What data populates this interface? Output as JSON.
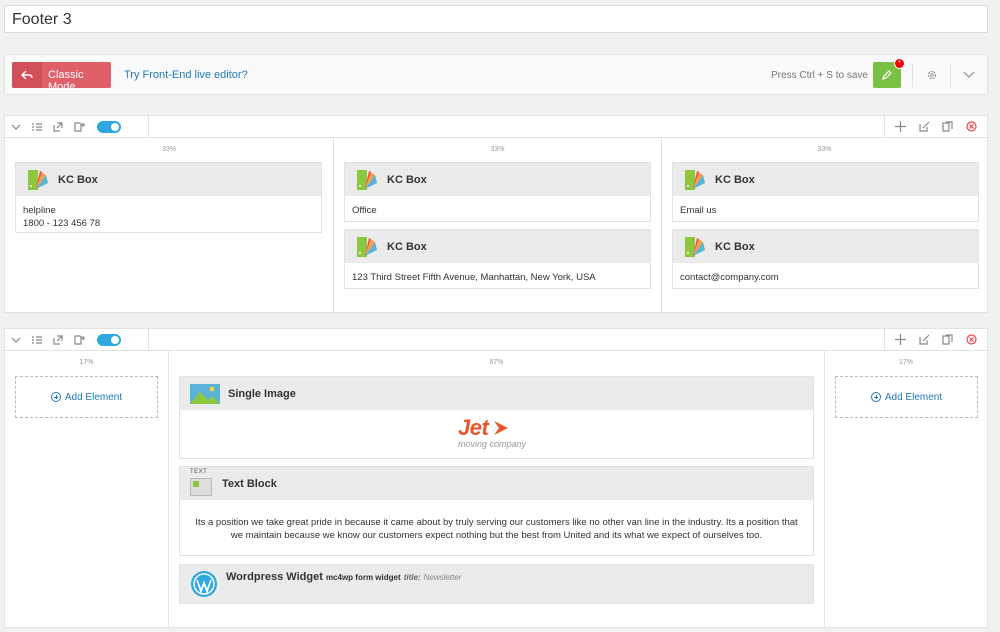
{
  "title": "Footer 3",
  "toolbar": {
    "classic_label": "Classic Mode",
    "frontend_link": "Try Front-End live editor?",
    "save_hint": "Press Ctrl + S to save",
    "save_badge": "*"
  },
  "colors": {
    "accent": "#1e7bb8",
    "classic": "#e0606a",
    "save": "#7ac143",
    "toggle": "#2ea8e0"
  },
  "row1": {
    "columns": [
      {
        "pct": "33%",
        "boxes": [
          {
            "title": "KC Box",
            "lines": [
              "helpline",
              "1800 - 123 456 78"
            ]
          }
        ]
      },
      {
        "pct": "33%",
        "boxes": [
          {
            "title": "KC Box",
            "lines": [
              "Office"
            ]
          },
          {
            "title": "KC Box",
            "lines": [
              "123 Third Street Fifth Avenue, Manhattan, New York, USA"
            ]
          }
        ]
      },
      {
        "pct": "33%",
        "boxes": [
          {
            "title": "KC Box",
            "lines": [
              "Email us"
            ]
          },
          {
            "title": "KC Box",
            "lines": [
              "contact@company.com"
            ]
          }
        ]
      }
    ]
  },
  "row2": {
    "left": {
      "pct": "17%",
      "add_label": "Add Element"
    },
    "center": {
      "pct": "67%",
      "single_image": {
        "title": "Single Image",
        "logo_main": "Jet",
        "logo_sub": "moving company"
      },
      "text_block": {
        "title": "Text Block",
        "icon_label": "TEXT",
        "text": "Its a position we take great pride in because it came about by truly serving our customers like no other van line in the industry. Its a position that we maintain because we know our customers expect nothing but the best from United and its what we expect of ourselves too."
      },
      "widget": {
        "title": "Wordpress Widget",
        "widget_name": "mc4wp form widget",
        "title_key": "title:",
        "title_value": "Newsletter"
      }
    },
    "right": {
      "pct": "17%",
      "add_label": "Add Element"
    }
  }
}
